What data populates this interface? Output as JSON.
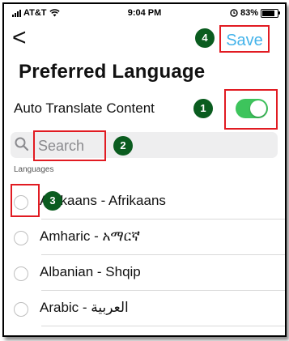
{
  "status_bar": {
    "carrier": "AT&T",
    "time": "9:04 PM",
    "battery_percent": "83%",
    "battery_level": 0.83
  },
  "nav": {
    "back_label": "<",
    "save_label": "Save"
  },
  "page_title": "Preferred Language",
  "auto_translate": {
    "label": "Auto Translate Content",
    "enabled": true
  },
  "search": {
    "placeholder": "Search"
  },
  "section_header": "Languages",
  "languages": [
    {
      "label": "Afrikaans - Afrikaans",
      "selected": false
    },
    {
      "label": "Amharic - አማርኛ",
      "selected": false
    },
    {
      "label": "Albanian - Shqip",
      "selected": false
    },
    {
      "label": "Arabic - العربية",
      "selected": false
    }
  ],
  "annotations": [
    "1",
    "2",
    "3",
    "4"
  ],
  "colors": {
    "accent": "#44b3ea",
    "toggle_on": "#3dc45c",
    "highlight": "#e11b22",
    "badge": "#0a5c1f"
  }
}
